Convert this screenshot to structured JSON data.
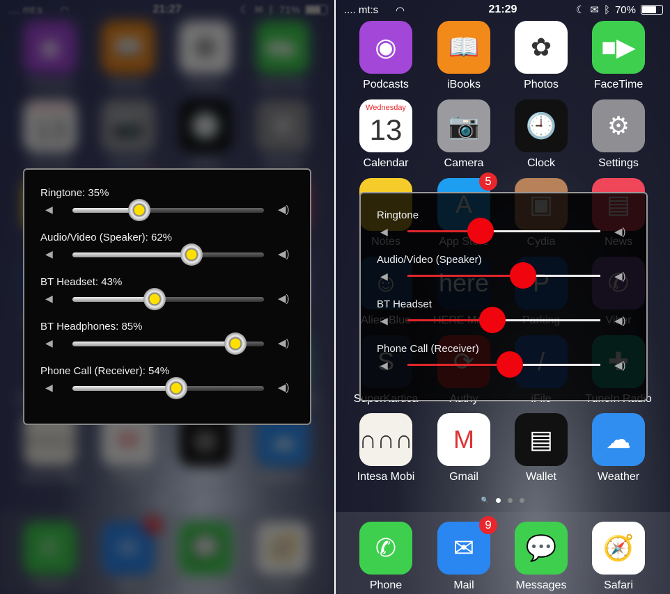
{
  "screens": [
    {
      "status": {
        "carrier": ".... mt:s",
        "time": "21:27",
        "battery": "71%",
        "battery_level": 0.71
      },
      "panel": {
        "rows": [
          {
            "label": "Ringtone: 35%",
            "value": 0.35
          },
          {
            "label": "Audio/Video (Speaker): 62%",
            "value": 0.62
          },
          {
            "label": "BT Headset: 43%",
            "value": 0.43
          },
          {
            "label": "BT Headphones: 85%",
            "value": 0.85
          },
          {
            "label": "Phone Call (Receiver): 54%",
            "value": 0.54
          }
        ]
      }
    },
    {
      "status": {
        "carrier": ".... mt:s",
        "time": "21:29",
        "battery": "70%",
        "battery_level": 0.7
      },
      "panel": {
        "rows": [
          {
            "label": "Ringtone",
            "value": 0.38
          },
          {
            "label": "Audio/Video (Speaker)",
            "value": 0.6
          },
          {
            "label": "BT Headset",
            "value": 0.44
          },
          {
            "label": "Phone Call (Receiver)",
            "value": 0.53
          }
        ]
      }
    }
  ],
  "apps": [
    {
      "name": "Podcasts",
      "color": "#a347d9",
      "glyph": "◉"
    },
    {
      "name": "iBooks",
      "color": "#f28a1a",
      "glyph": "📖"
    },
    {
      "name": "Photos",
      "color": "#ffffff",
      "glyph": "✿"
    },
    {
      "name": "FaceTime",
      "color": "#3fcf4f",
      "glyph": "■▶"
    },
    {
      "name": "Calendar",
      "color": "#ffffff",
      "glyph": "13",
      "sub": "Wednesday"
    },
    {
      "name": "Camera",
      "color": "#9a9a9f",
      "glyph": "📷"
    },
    {
      "name": "Clock",
      "color": "#111111",
      "glyph": "🕘"
    },
    {
      "name": "Settings",
      "color": "#8e8e93",
      "glyph": "⚙"
    },
    {
      "name": "Notes",
      "color": "#f5cc2a",
      "glyph": ""
    },
    {
      "name": "App Store",
      "color": "#1e9ef0",
      "glyph": "A",
      "badge": "5"
    },
    {
      "name": "Cydia",
      "color": "#b7815a",
      "glyph": "▣"
    },
    {
      "name": "News",
      "color": "#f0465a",
      "glyph": "▤"
    },
    {
      "name": "Alien Blue",
      "color": "#1d4f8c",
      "glyph": "☺"
    },
    {
      "name": "HERE Maps",
      "color": "#143a6b",
      "glyph": "here"
    },
    {
      "name": "Parking",
      "color": "#1d5fb0",
      "glyph": "P"
    },
    {
      "name": "Viber",
      "color": "#6d4fa1",
      "glyph": "✆"
    },
    {
      "name": "SuperKartica",
      "color": "#2a3a5a",
      "glyph": "S"
    },
    {
      "name": "Authy",
      "color": "#d9302f",
      "glyph": "⟳"
    },
    {
      "name": "iFile",
      "color": "#2a64c8",
      "glyph": "/"
    },
    {
      "name": "TuneIn Radio",
      "color": "#1f9e85",
      "glyph": "✚"
    },
    {
      "name": "Intesa Mobi",
      "color": "#f4f1ea",
      "glyph": "∩∩∩"
    },
    {
      "name": "Gmail",
      "color": "#ffffff",
      "glyph": "M"
    },
    {
      "name": "Wallet",
      "color": "#111111",
      "glyph": "▤"
    },
    {
      "name": "Weather",
      "color": "#2f8ef0",
      "glyph": "☁"
    }
  ],
  "dock": [
    {
      "name": "Phone",
      "color": "#3fcf4f",
      "glyph": "✆"
    },
    {
      "name": "Mail",
      "color": "#2a86f0",
      "glyph": "✉",
      "badge": "9"
    },
    {
      "name": "Messages",
      "color": "#3fcf4f",
      "glyph": "💬"
    },
    {
      "name": "Safari",
      "color": "#ffffff",
      "glyph": "🧭"
    }
  ]
}
